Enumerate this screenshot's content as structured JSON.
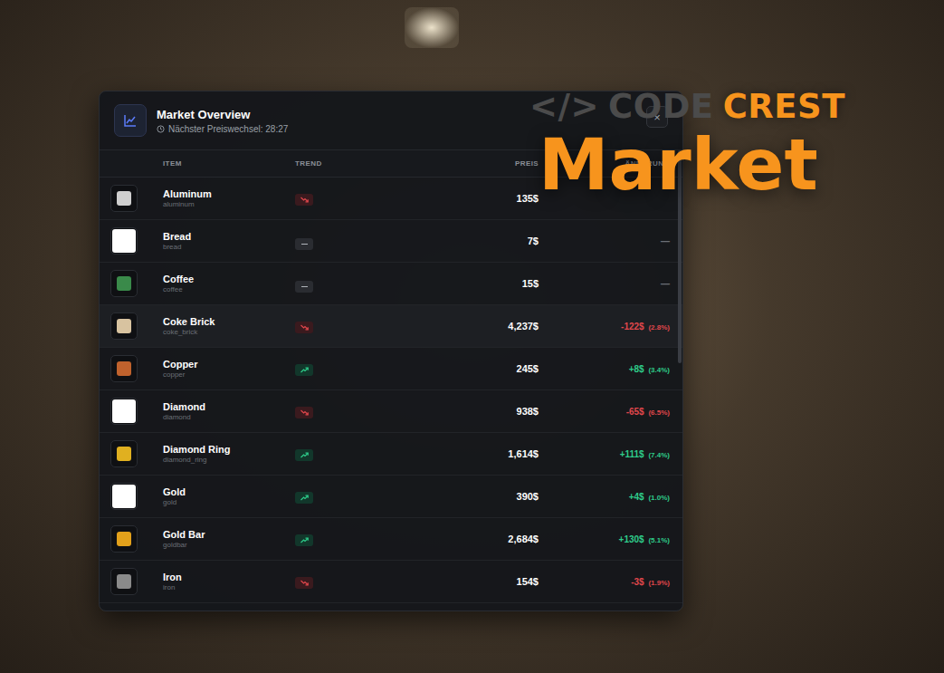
{
  "overlay": {
    "code_mark": "</>",
    "brand_word": "CODE",
    "brand_accent": "CREST",
    "headline": "Market"
  },
  "panel": {
    "title": "Market Overview",
    "subtitle": "Nächster Preiswechsel: 28:27",
    "close": "×"
  },
  "table": {
    "columns": [
      "ITEM",
      "TREND",
      "PREIS",
      "ÄNDERUNG"
    ],
    "rows": [
      {
        "name": "Aluminum",
        "id_label": "aluminum",
        "trend": "down",
        "price": "135$",
        "change": "",
        "change_pct": "",
        "has_image": true,
        "color": "#cfcfcf",
        "highlighted": false
      },
      {
        "name": "Bread",
        "id_label": "bread",
        "trend": "flat",
        "price": "7$",
        "change": "—",
        "change_pct": "",
        "has_image": false,
        "color": "#ffffff",
        "highlighted": false
      },
      {
        "name": "Coffee",
        "id_label": "coffee",
        "trend": "flat",
        "price": "15$",
        "change": "—",
        "change_pct": "",
        "has_image": true,
        "color": "#3a8a4a",
        "highlighted": false
      },
      {
        "name": "Coke Brick",
        "id_label": "coke_brick",
        "trend": "down",
        "price": "4,237$",
        "change": "-122$",
        "change_pct": "(2.8%)",
        "has_image": true,
        "color": "#d8c3a0",
        "highlighted": true
      },
      {
        "name": "Copper",
        "id_label": "copper",
        "trend": "up",
        "price": "245$",
        "change": "+8$",
        "change_pct": "(3.4%)",
        "has_image": true,
        "color": "#c0622d",
        "highlighted": false
      },
      {
        "name": "Diamond",
        "id_label": "diamond",
        "trend": "down",
        "price": "938$",
        "change": "-65$",
        "change_pct": "(6.5%)",
        "has_image": false,
        "color": "#ffffff",
        "highlighted": false
      },
      {
        "name": "Diamond Ring",
        "id_label": "diamond_ring",
        "trend": "up",
        "price": "1,614$",
        "change": "+111$",
        "change_pct": "(7.4%)",
        "has_image": true,
        "color": "#e0b020",
        "highlighted": false
      },
      {
        "name": "Gold",
        "id_label": "gold",
        "trend": "up",
        "price": "390$",
        "change": "+4$",
        "change_pct": "(1.0%)",
        "has_image": false,
        "color": "#ffffff",
        "highlighted": false
      },
      {
        "name": "Gold Bar",
        "id_label": "goldbar",
        "trend": "up",
        "price": "2,684$",
        "change": "+130$",
        "change_pct": "(5.1%)",
        "has_image": true,
        "color": "#e3a11b",
        "highlighted": false
      },
      {
        "name": "Iron",
        "id_label": "iron",
        "trend": "down",
        "price": "154$",
        "change": "-3$",
        "change_pct": "(1.9%)",
        "has_image": true,
        "color": "#8a8a8a",
        "highlighted": false
      }
    ]
  }
}
